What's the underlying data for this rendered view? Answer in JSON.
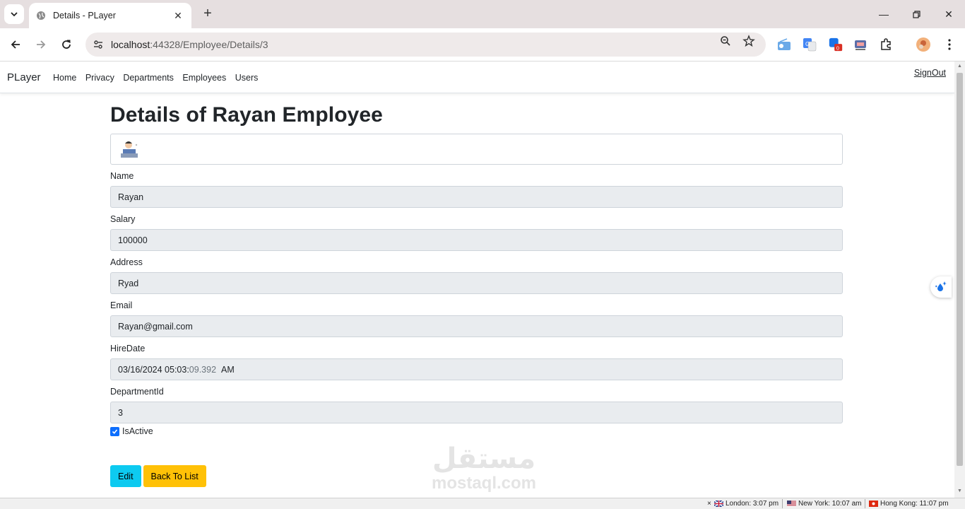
{
  "browser": {
    "tab_title": "Details - PLayer",
    "url_host": "localhost",
    "url_path": ":44328/Employee/Details/3"
  },
  "navbar": {
    "brand": "PLayer",
    "links": [
      "Home",
      "Privacy",
      "Departments",
      "Employees",
      "Users"
    ],
    "signout": "SignOut"
  },
  "page": {
    "heading": "Details of Rayan Employee",
    "fields": {
      "name_label": "Name",
      "name_value": "Rayan",
      "salary_label": "Salary",
      "salary_value": "100000",
      "address_label": "Address",
      "address_value": "Ryad",
      "email_label": "Email",
      "email_value": "Rayan@gmail.com",
      "hiredate_label": "HireDate",
      "hiredate_main": "03/16/2024 05:03:",
      "hiredate_ms": "09.392",
      "hiredate_ampm": "AM",
      "department_label": "DepartmentId",
      "department_value": "3"
    },
    "isactive_label": "IsActive",
    "isactive_checked": true,
    "buttons": {
      "edit": "Edit",
      "back": "Back To List"
    }
  },
  "watermark": {
    "arabic": "مستقل",
    "latin": "mostaql.com"
  },
  "statusbar": {
    "close": "×",
    "clocks": [
      "London: 3:07 pm",
      "New York: 10:07 am",
      "Hong Kong: 11:07 pm"
    ]
  },
  "colors": {
    "edit_button": "#0dcaf0",
    "back_button": "#ffc107",
    "checkbox": "#0d6efd",
    "readonly_field": "#e9ecef"
  }
}
